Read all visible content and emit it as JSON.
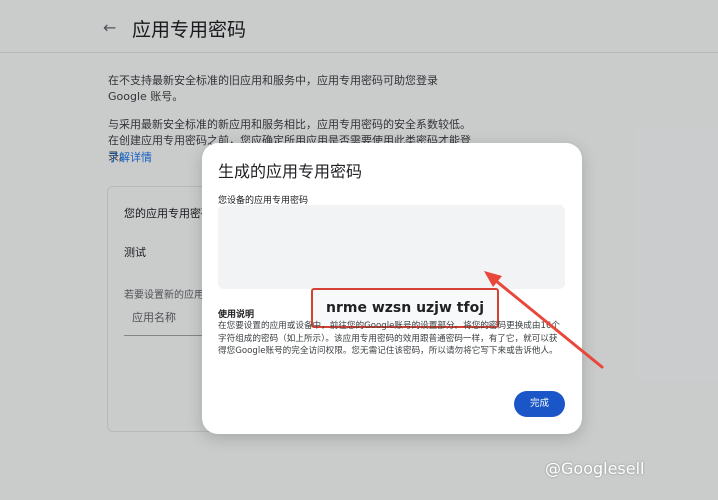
{
  "header": {
    "title": "应用专用密码"
  },
  "intro": {
    "p1": "在不支持最新安全标准的旧应用和服务中，应用专用密码可助您登录 Google 账号。",
    "p2": "与采用最新安全标准的新应用和服务相比，应用专用密码的安全系数较低。在创建应用专用密码之前，您应确定所用应用是否需要使用此类密码才能登录。",
    "link": "了解详情"
  },
  "card": {
    "title": "您的应用专用密码",
    "item": "测试",
    "hint": "若要设置新的应用",
    "placeholder": "应用名称"
  },
  "dialog": {
    "title": "生成的应用专用密码",
    "label": "您设备的应用专用密码",
    "password": "nrme wzsn uzjw tfoj",
    "usage_title": "使用说明",
    "usage_text": "在您要设置的应用或设备中，前往您的Google账号的设置部分。将您的密码更换成由16个字符组成的密码（如上所示）。该应用专用密码的效用跟普通密码一样，有了它，就可以获得您Google账号的完全访问权限。您无需记住该密码，所以请勿将它写下来或告诉他人。",
    "done": "完成"
  },
  "watermark": "@Googlesell",
  "colors": {
    "accent": "#1a56c8",
    "highlight": "#d64032"
  },
  "icons": {
    "back": "arrow-back-icon"
  }
}
